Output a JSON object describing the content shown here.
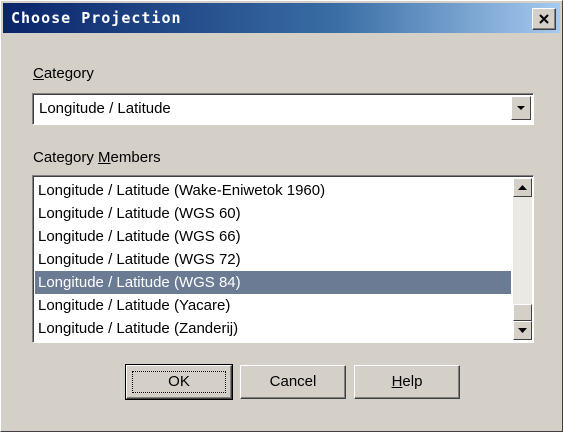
{
  "dialog": {
    "title": "Choose Projection"
  },
  "category": {
    "label_prefix": "",
    "label_accel": "C",
    "label_rest": "ategory",
    "value": "Longitude / Latitude"
  },
  "members": {
    "label_prefix": "Category ",
    "label_accel": "M",
    "label_rest": "embers",
    "items": [
      "Longitude / Latitude (Wake-Eniwetok 1960)",
      "Longitude / Latitude (WGS 60)",
      "Longitude / Latitude (WGS 66)",
      "Longitude / Latitude (WGS 72)",
      "Longitude / Latitude (WGS 84)",
      "Longitude / Latitude (Yacare)",
      "Longitude / Latitude (Zanderij)"
    ],
    "selected_index": 4
  },
  "buttons": {
    "ok": "OK",
    "cancel": "Cancel",
    "help_accel": "H",
    "help_rest": "elp"
  },
  "colors": {
    "face": "#d4d0c8",
    "title_start": "#0a246a",
    "selection": "#6b7b94"
  }
}
